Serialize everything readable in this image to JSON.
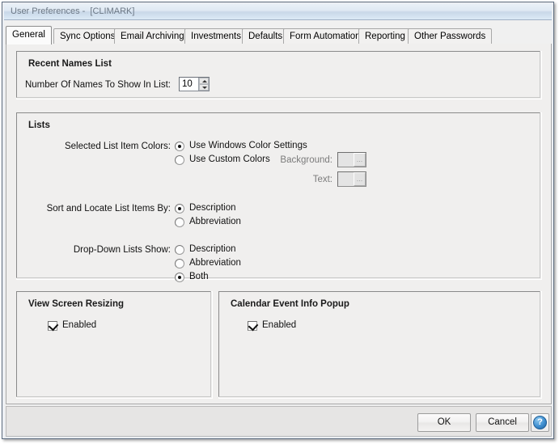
{
  "window": {
    "title": "User Preferences -  [CLIMARK]"
  },
  "tabs": [
    {
      "label": "General",
      "active": true
    },
    {
      "label": "Sync Options",
      "active": false
    },
    {
      "label": "Email Archiving",
      "active": false
    },
    {
      "label": "Investments",
      "active": false
    },
    {
      "label": "Defaults",
      "active": false
    },
    {
      "label": "Form Automation",
      "active": false
    },
    {
      "label": "Reporting",
      "active": false
    },
    {
      "label": "Other Passwords",
      "active": false
    }
  ],
  "recent_names": {
    "group_title": "Recent Names List",
    "count_label": "Number Of Names To Show In List:",
    "count_value": "10"
  },
  "lists": {
    "group_title": "Lists",
    "colors_label": "Selected List Item Colors:",
    "colors_options": [
      {
        "label": "Use Windows Color Settings",
        "selected": true
      },
      {
        "label": "Use Custom Colors",
        "selected": false
      }
    ],
    "background_label": "Background:",
    "text_label": "Text:",
    "ellipsis_label": "...",
    "sort_label": "Sort and Locate List Items By:",
    "sort_options": [
      {
        "label": "Description",
        "selected": true
      },
      {
        "label": "Abbreviation",
        "selected": false
      }
    ],
    "dropdown_label": "Drop-Down Lists Show:",
    "dropdown_options": [
      {
        "label": "Description",
        "selected": false
      },
      {
        "label": "Abbreviation",
        "selected": false
      },
      {
        "label": "Both",
        "selected": true
      }
    ]
  },
  "view_resizing": {
    "group_title": "View Screen Resizing",
    "enabled_label": "Enabled",
    "enabled_checked": true
  },
  "calendar_popup": {
    "group_title": "Calendar Event Info Popup",
    "enabled_label": "Enabled",
    "enabled_checked": true
  },
  "footer": {
    "ok_label": "OK",
    "cancel_label": "Cancel",
    "help_label": "?"
  },
  "colors": {
    "titlebar_accent": "#c9d8e8",
    "panel_bg": "#f0efee",
    "frame_border": "#5b6b80",
    "help_blue": "#3f8fd0",
    "disabled_text": "#7b7b7b"
  }
}
